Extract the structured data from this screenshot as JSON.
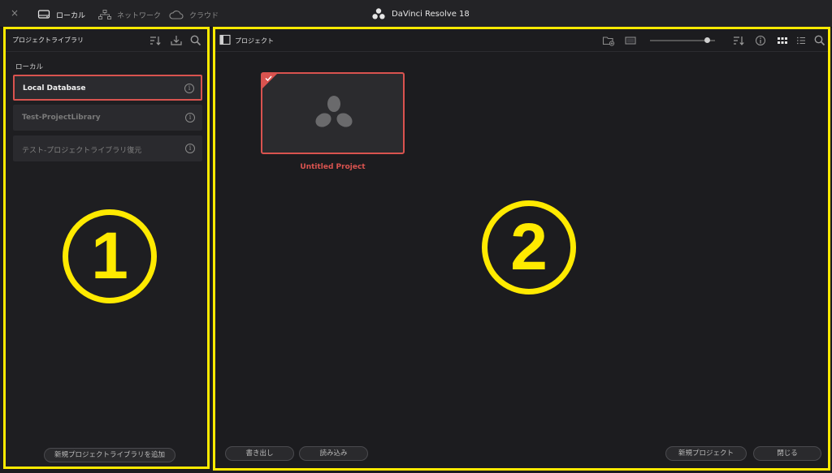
{
  "topbar": {
    "close_glyph": "×",
    "tabs": [
      {
        "label": "ローカル",
        "icon": "local-drive-icon",
        "active": true
      },
      {
        "label": "ネットワーク",
        "icon": "network-icon",
        "active": false
      },
      {
        "label": "クラウド",
        "icon": "cloud-icon",
        "active": false
      }
    ],
    "app_title": "DaVinci Resolve 18"
  },
  "library_panel": {
    "title": "プロジェクトライブラリ",
    "section_label": "ローカル",
    "libraries": [
      {
        "label": "Local Database",
        "selected": true
      },
      {
        "label": "Test-ProjectLibrary",
        "selected": false
      },
      {
        "label": "テスト-プロジェクトライブラリ復元",
        "selected": false
      }
    ],
    "info_glyph": "i",
    "add_button_label": "新規プロジェクトライブラリを追加",
    "annotation_number": "1"
  },
  "project_panel": {
    "title": "プロジェクト",
    "projects": [
      {
        "name": "Untitled Project",
        "selected": true
      }
    ],
    "export_label": "書き出し",
    "import_label": "読み込み",
    "new_project_label": "新規プロジェクト",
    "close_label": "閉じる",
    "annotation_number": "2",
    "thumbnail_zoom": 0.85
  },
  "colors": {
    "annotation": "#ffea00",
    "selection": "#d9534f",
    "background": "#1c1c1f"
  }
}
